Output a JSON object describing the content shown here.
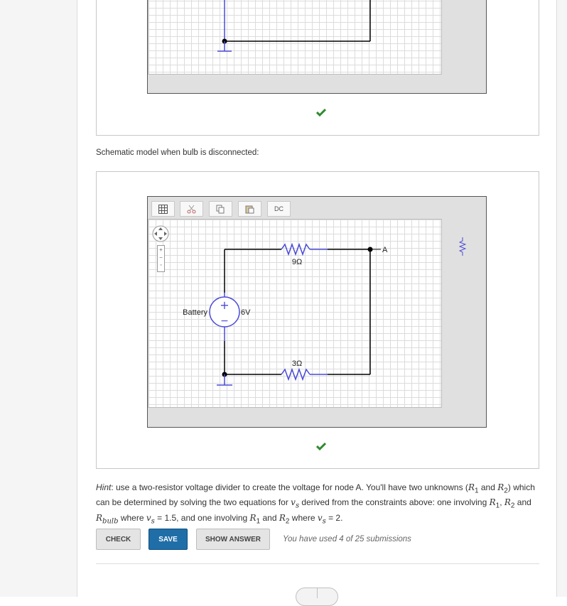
{
  "caption": "Schematic model when bulb is disconnected:",
  "toolbar": {
    "dc_label": "DC",
    "icons": [
      "grid-icon",
      "cut-icon",
      "copy-icon",
      "paste-icon"
    ]
  },
  "circuit": {
    "node_label": "A",
    "resistor_top_label": "9Ω",
    "resistor_bottom_label": "3Ω",
    "battery_label": "Battery",
    "battery_value": "6V",
    "plus_sign": "+",
    "minus_sign": "−"
  },
  "hint": {
    "lead": "Hint",
    "text_1": ": use a two-resistor voltage divider to create the voltage for node A. You'll have two unknowns (",
    "r1": "R",
    "r1_sub": "1",
    "and_1": " and ",
    "r2": "R",
    "r2_sub": "2",
    "text_2": ") which can be determined by solving the two equations for ",
    "vs": "v",
    "vs_sub": "s",
    "text_3": " derived from the constraints above: one involving ",
    "text_4": ", ",
    "text_5": " and ",
    "rbulb_sub": "bulb",
    "text_6": " where ",
    "eq_1": " = 1.5",
    "text_7": ", and one involving ",
    "text_8": " and ",
    "text_9": " where ",
    "eq_2": " = 2",
    "text_10": "."
  },
  "buttons": {
    "check": "CHECK",
    "save": "SAVE",
    "show_answer": "SHOW ANSWER"
  },
  "submissions": "You have used 4 of 25 submissions",
  "colors": {
    "wire": "#000000",
    "component": "#4a4ad8",
    "check": "#2e8b2e",
    "save_button": "#1f6ea8"
  }
}
